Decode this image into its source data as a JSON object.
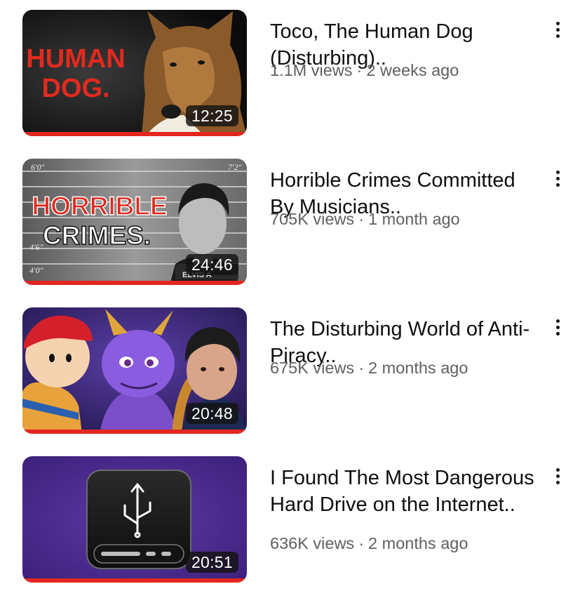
{
  "videos": [
    {
      "title": "Toco, The Human Dog (Disturbing)..",
      "views": "1.1M views",
      "age": "2 weeks ago",
      "duration": "12:25",
      "thumb_text": [
        "HUMAN",
        "DOG."
      ],
      "watched": 1.0
    },
    {
      "title": "Horrible Crimes Committed By Musicians..",
      "views": "705K views",
      "age": "1 month ago",
      "duration": "24:46",
      "thumb_text": [
        "HORRIBLE",
        "CRIMES."
      ],
      "height_marks": [
        "6'0\"",
        "4'6\"",
        "4'0\"",
        "7'2\""
      ],
      "placard": "ELVIS    A",
      "watched": 1.0
    },
    {
      "title": "The Disturbing World of Anti-Piracy..",
      "views": "675K views",
      "age": "2 months ago",
      "duration": "20:48",
      "watched": 1.0
    },
    {
      "title": "I Found The Most Dangerous Hard Drive on the Internet..",
      "views": "636K views",
      "age": "2 months ago",
      "duration": "20:51",
      "watched": 1.0
    }
  ],
  "meta_separator": "·",
  "colors": {
    "progress": "#e3261f",
    "title": "#0f0f0f",
    "meta": "#606060"
  },
  "icons": {
    "more": "more-vert-icon",
    "usb": "usb-icon"
  }
}
